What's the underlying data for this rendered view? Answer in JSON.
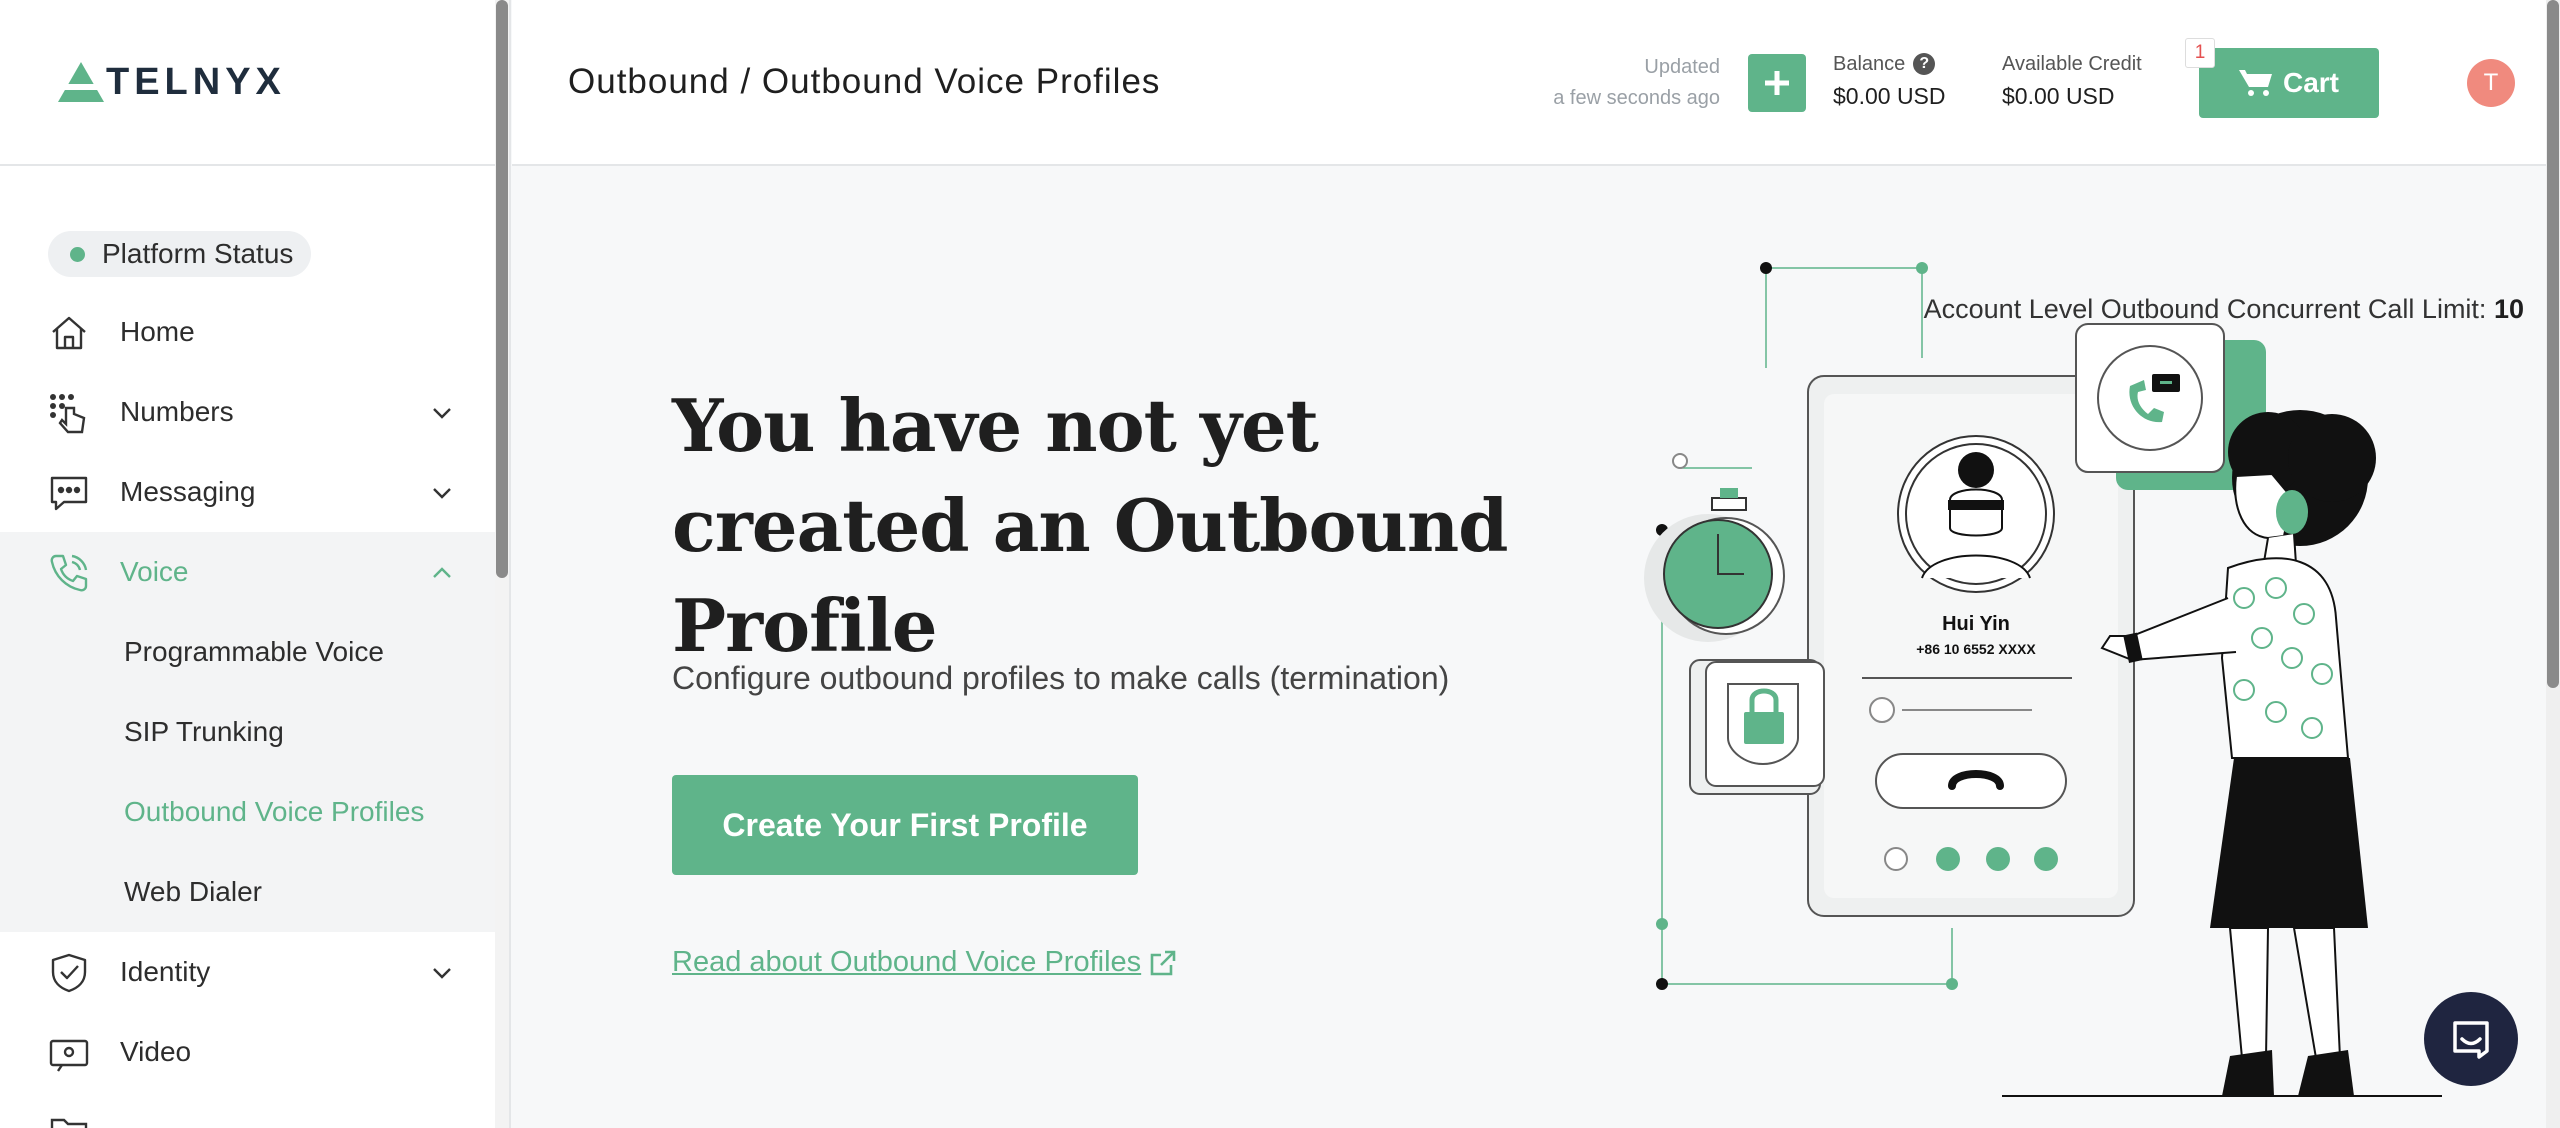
{
  "brand": {
    "name": "TELNYX"
  },
  "sidebar": {
    "status": "Platform Status",
    "items": [
      {
        "label": "Home",
        "icon": "home-icon"
      },
      {
        "label": "Numbers",
        "icon": "numbers-icon"
      },
      {
        "label": "Messaging",
        "icon": "messaging-icon"
      },
      {
        "label": "Voice",
        "icon": "voice-icon"
      },
      {
        "label": "Identity",
        "icon": "identity-icon"
      },
      {
        "label": "Video",
        "icon": "video-icon"
      }
    ],
    "voice_sub": [
      {
        "label": "Programmable Voice"
      },
      {
        "label": "SIP Trunking"
      },
      {
        "label": "Outbound Voice Profiles"
      },
      {
        "label": "Web Dialer"
      }
    ]
  },
  "header": {
    "breadcrumb": "Outbound / Outbound Voice Profiles",
    "updated_label": "Updated",
    "updated_time": "a few seconds ago",
    "balance_label": "Balance",
    "balance_value": "$0.00 USD",
    "credit_label": "Available Credit",
    "credit_value": "$0.00 USD",
    "cart_label": "Cart",
    "cart_count": "1",
    "avatar_initial": "T"
  },
  "main": {
    "limit_label": "Account Level Outbound Concurrent Call Limit:",
    "limit_value": "10",
    "headline": "You have not yet created an Outbound Profile",
    "description": "Configure outbound profiles to make calls (termination)",
    "cta": "Create Your First Profile",
    "link": "Read about Outbound Voice Profiles"
  },
  "illustration": {
    "contact_name": "Hui Yin",
    "contact_number": "+86 10 6552 XXXX"
  },
  "colors": {
    "accent": "#5fb48a",
    "dark": "#1f2540",
    "avatar": "#f08a7e"
  }
}
